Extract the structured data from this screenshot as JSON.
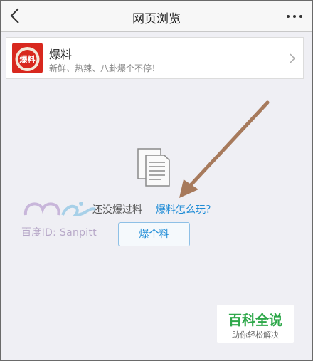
{
  "header": {
    "title": "网页浏览"
  },
  "card": {
    "title": "爆料",
    "subtitle": "新鲜、热辣、八卦爆个不停！",
    "logo_text": "爆料"
  },
  "empty_state": {
    "message": "还没爆过料",
    "help_link": "爆料怎么玩？",
    "action_button": "爆个料"
  },
  "watermark": {
    "user": "百度ID: Sanpitt"
  },
  "badge": {
    "title": "百科全说",
    "subtitle": "助你轻松解决"
  },
  "colors": {
    "accent": "#1d8bd6",
    "logo_red": "#d8281e",
    "arrow": "#a77a5c",
    "badge_green": "#2ea84a"
  },
  "icons": [
    "back-arrow-icon",
    "more-icon",
    "chevron-right-icon",
    "document-icon"
  ]
}
